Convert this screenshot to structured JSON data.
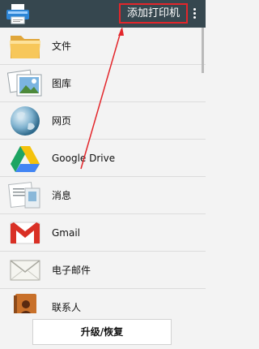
{
  "header": {
    "add_printer_label": "添加打印机",
    "menu_icon": "more-vert-icon"
  },
  "list": {
    "items": [
      {
        "label": "文件",
        "icon": "folder-icon"
      },
      {
        "label": "图库",
        "icon": "gallery-icon"
      },
      {
        "label": "网页",
        "icon": "globe-icon"
      },
      {
        "label": "Google Drive",
        "icon": "google-drive-icon"
      },
      {
        "label": "消息",
        "icon": "message-icon"
      },
      {
        "label": "Gmail",
        "icon": "gmail-icon"
      },
      {
        "label": "电子邮件",
        "icon": "email-icon"
      },
      {
        "label": "联系人",
        "icon": "contacts-icon"
      }
    ]
  },
  "footer": {
    "upgrade_label": "升级/恢复"
  },
  "colors": {
    "appbar": "#36474f",
    "highlight": "#e3262b"
  }
}
